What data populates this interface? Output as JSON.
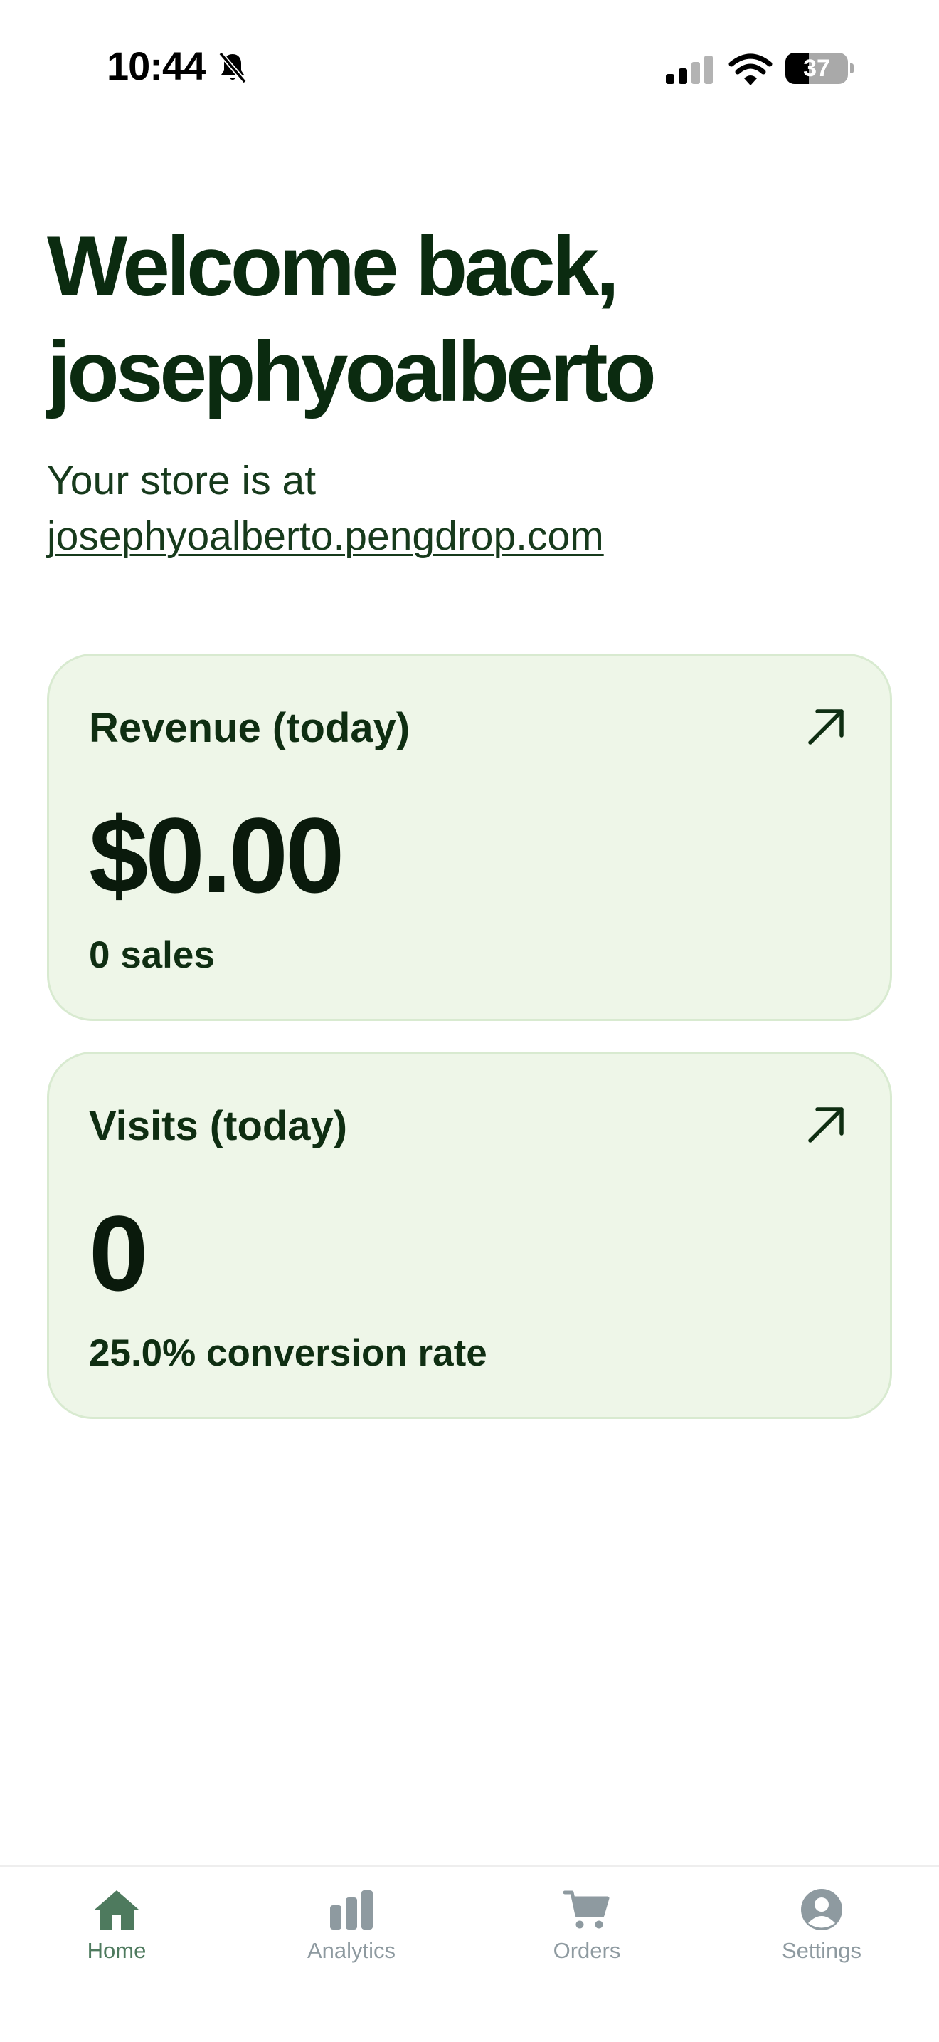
{
  "status_bar": {
    "time": "10:44",
    "battery_level": "37",
    "battery_fraction": 0.37,
    "icons": [
      "bell-slash-icon",
      "cellular-signal-icon",
      "wifi-icon",
      "battery-icon"
    ]
  },
  "header": {
    "title_line1": "Welcome back,",
    "title_line2": "josephyoalberto",
    "store_prefix": "Your store is at",
    "store_url": "josephyoalberto.pengdrop.com"
  },
  "cards": {
    "revenue": {
      "label": "Revenue (today)",
      "value": "$0.00",
      "sub": "0 sales",
      "icon": "arrow-up-right-icon"
    },
    "visits": {
      "label": "Visits (today)",
      "value": "0",
      "sub": "25.0% conversion rate",
      "icon": "arrow-up-right-icon"
    }
  },
  "bottom_nav": {
    "active": "home",
    "items": [
      {
        "label": "Home",
        "icon": "home-icon"
      },
      {
        "label": "Analytics",
        "icon": "bar-chart-icon"
      },
      {
        "label": "Orders",
        "icon": "cart-icon"
      },
      {
        "label": "Settings",
        "icon": "user-circle-icon"
      }
    ]
  },
  "colors": {
    "primary_text": "#0b2b10",
    "card_background": "#eef6e8",
    "card_border": "#d8ead0",
    "nav_active": "#4e7a5e",
    "nav_inactive": "#8e9aa0"
  }
}
